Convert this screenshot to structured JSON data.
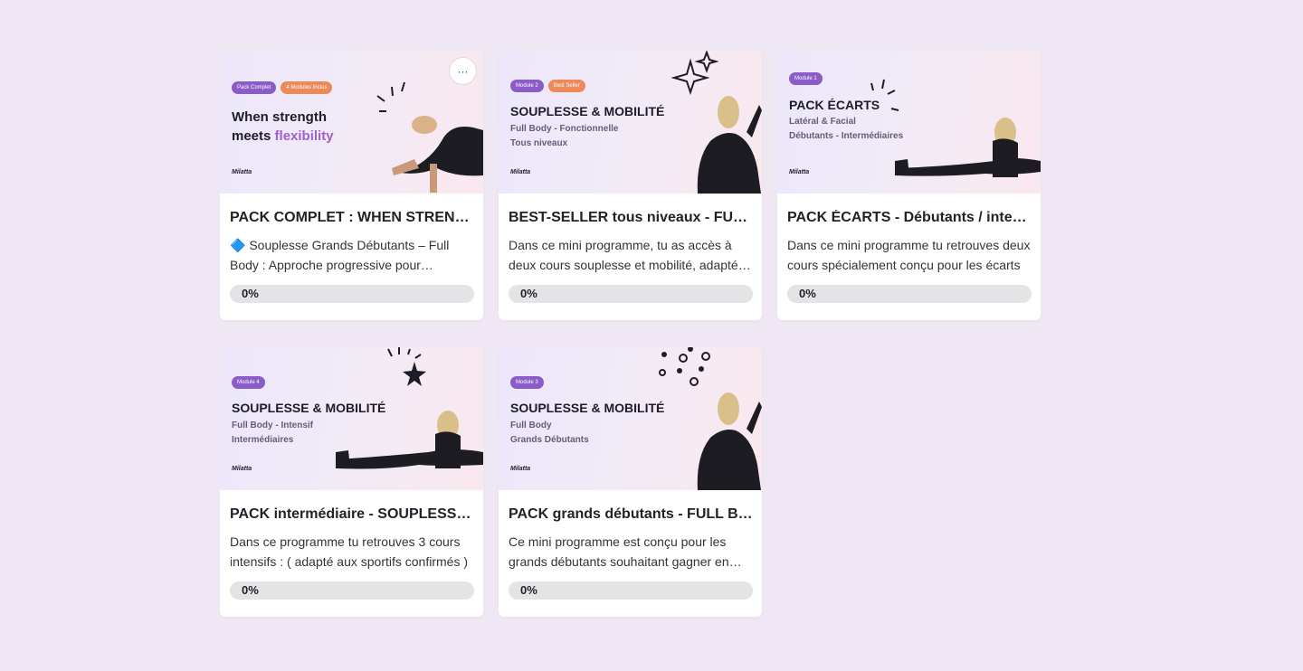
{
  "cards": [
    {
      "thumb": {
        "badges": [
          {
            "text": "Pack Complet",
            "color": "purple"
          },
          {
            "text": "4 Modules Inclus",
            "color": "orange"
          }
        ],
        "heading_1": "When strength",
        "heading_2a": "meets",
        "heading_2b": "flexibility",
        "logo": "Milatta"
      },
      "more_label": "···",
      "title": "PACK COMPLET : WHEN STRENGTH MEETS FLEXIBILITY",
      "description": "🔷 Souplesse Grands Débutants – Full Body : Approche progressive pour démarrer en douceur",
      "progress_label": "0%",
      "progress_value": 0
    },
    {
      "thumb": {
        "badges": [
          {
            "text": "Module 2",
            "color": "purple"
          },
          {
            "text": "Best Seller",
            "color": "orange"
          }
        ],
        "heading": "SOUPLESSE & MOBILITÉ",
        "sub": [
          "Full Body - Fonctionnelle",
          "Tous niveaux"
        ],
        "logo": "Milatta"
      },
      "title": "BEST-SELLER tous niveaux - FULL BODY",
      "description": "Dans ce mini programme, tu as accès à deux cours souplesse et mobilité, adaptés à tous les niveaux",
      "progress_label": "0%",
      "progress_value": 0
    },
    {
      "thumb": {
        "badges": [
          {
            "text": "Module 1",
            "color": "purple"
          }
        ],
        "heading": "PACK ÉCARTS",
        "sub": [
          "Latéral & Facial",
          "Débutants - Intermédiaires"
        ],
        "logo": "Milatta"
      },
      "title": "PACK ÉCARTS - Débutants / intermédiaires",
      "description": "Dans ce mini programme tu retrouves deux cours spécialement conçu pour les écarts",
      "progress_label": "0%",
      "progress_value": 0
    },
    {
      "thumb": {
        "badges": [
          {
            "text": "Module 4",
            "color": "purple"
          }
        ],
        "heading": "SOUPLESSE & MOBILITÉ",
        "sub": [
          "Full Body - Intensif",
          "Intermédiaires"
        ],
        "logo": "Milatta"
      },
      "title": "PACK intermédiaire - SOUPLESSE & MOBILITÉ",
      "description": "Dans ce programme tu retrouves 3 cours intensifs : ( adapté aux sportifs confirmés )",
      "progress_label": "0%",
      "progress_value": 0
    },
    {
      "thumb": {
        "badges": [
          {
            "text": "Module 3",
            "color": "purple"
          }
        ],
        "heading": "SOUPLESSE & MOBILITÉ",
        "sub": [
          "Full Body",
          "Grands Débutants"
        ],
        "logo": "Milatta"
      },
      "title": "PACK grands débutants - FULL BODY",
      "description": "Ce mini programme est conçu pour les grands débutants souhaitant gagner en souplesse",
      "progress_label": "0%",
      "progress_value": 0
    }
  ],
  "colors": {
    "page_bg": "#efe8f4",
    "badge_purple": "#8a5cc7",
    "badge_orange": "#ec8a5a",
    "accent_flexibility": "#a35fd0"
  }
}
